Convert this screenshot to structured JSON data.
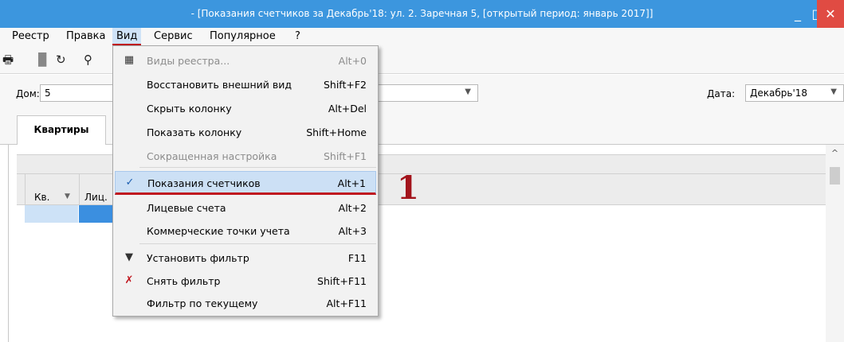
{
  "window": {
    "title": "- [Показания счетчиков за  Декабрь'18: ул. 2. Заречная 5, [открытый период: январь 2017]]",
    "minimize_glyph": "_",
    "maximize_glyph": "□",
    "close_glyph": "✕"
  },
  "menubar": {
    "items": [
      {
        "label": "Реестр"
      },
      {
        "label": "Правка"
      },
      {
        "label": "Вид"
      },
      {
        "label": "Сервис"
      },
      {
        "label": "Популярное"
      },
      {
        "label": "?"
      }
    ]
  },
  "toolbar": {
    "icons": [
      {
        "name": "print-icon",
        "glyph": "🖶"
      },
      {
        "name": "save-icon",
        "glyph": "▉"
      },
      {
        "name": "refresh-icon",
        "glyph": "↻"
      },
      {
        "name": "search-icon",
        "glyph": "⚲"
      }
    ]
  },
  "filter": {
    "dom_label": "Дом:",
    "dom_value": "5",
    "date_label": "Дата:",
    "date_value": "Декабрь'18"
  },
  "tabs": [
    {
      "label": "Квартиры"
    }
  ],
  "grid": {
    "columns": [
      {
        "label": "Кв."
      },
      {
        "label": "Лиц."
      }
    ]
  },
  "dropdown": {
    "items": [
      {
        "label": "Виды реестра...",
        "shortcut": "Alt+0",
        "icon": "grid-icon",
        "glyph": "▦",
        "disabled": true
      },
      {
        "label": "Восстановить внешний вид",
        "shortcut": "Shift+F2"
      },
      {
        "label": "Скрыть колонку",
        "shortcut": "Alt+Del"
      },
      {
        "label": "Показать колонку",
        "shortcut": "Shift+Home"
      },
      {
        "label": "Сокращенная настройка",
        "shortcut": "Shift+F1",
        "disabled": true
      },
      {
        "label": "Показания счетчиков",
        "shortcut": "Alt+1",
        "icon": "checkmark-icon",
        "glyph": "✓",
        "selected": true
      },
      {
        "label": "Лицевые счета",
        "shortcut": "Alt+2"
      },
      {
        "label": "Коммерческие точки учета",
        "shortcut": "Alt+3"
      },
      {
        "label": "Установить фильтр",
        "shortcut": "F11",
        "icon": "filter-icon",
        "glyph": "▼"
      },
      {
        "label": "Снять фильтр",
        "shortcut": "Shift+F11",
        "icon": "remove-filter-icon",
        "glyph": "✗"
      },
      {
        "label": "Фильтр по текущему",
        "shortcut": "Alt+F11"
      }
    ]
  },
  "annotation": {
    "label": "1"
  },
  "colors": {
    "titlebar": "#3c96de",
    "close_button": "#e04b43",
    "annotation": "#a3141c",
    "selection": "#cce0f5"
  }
}
